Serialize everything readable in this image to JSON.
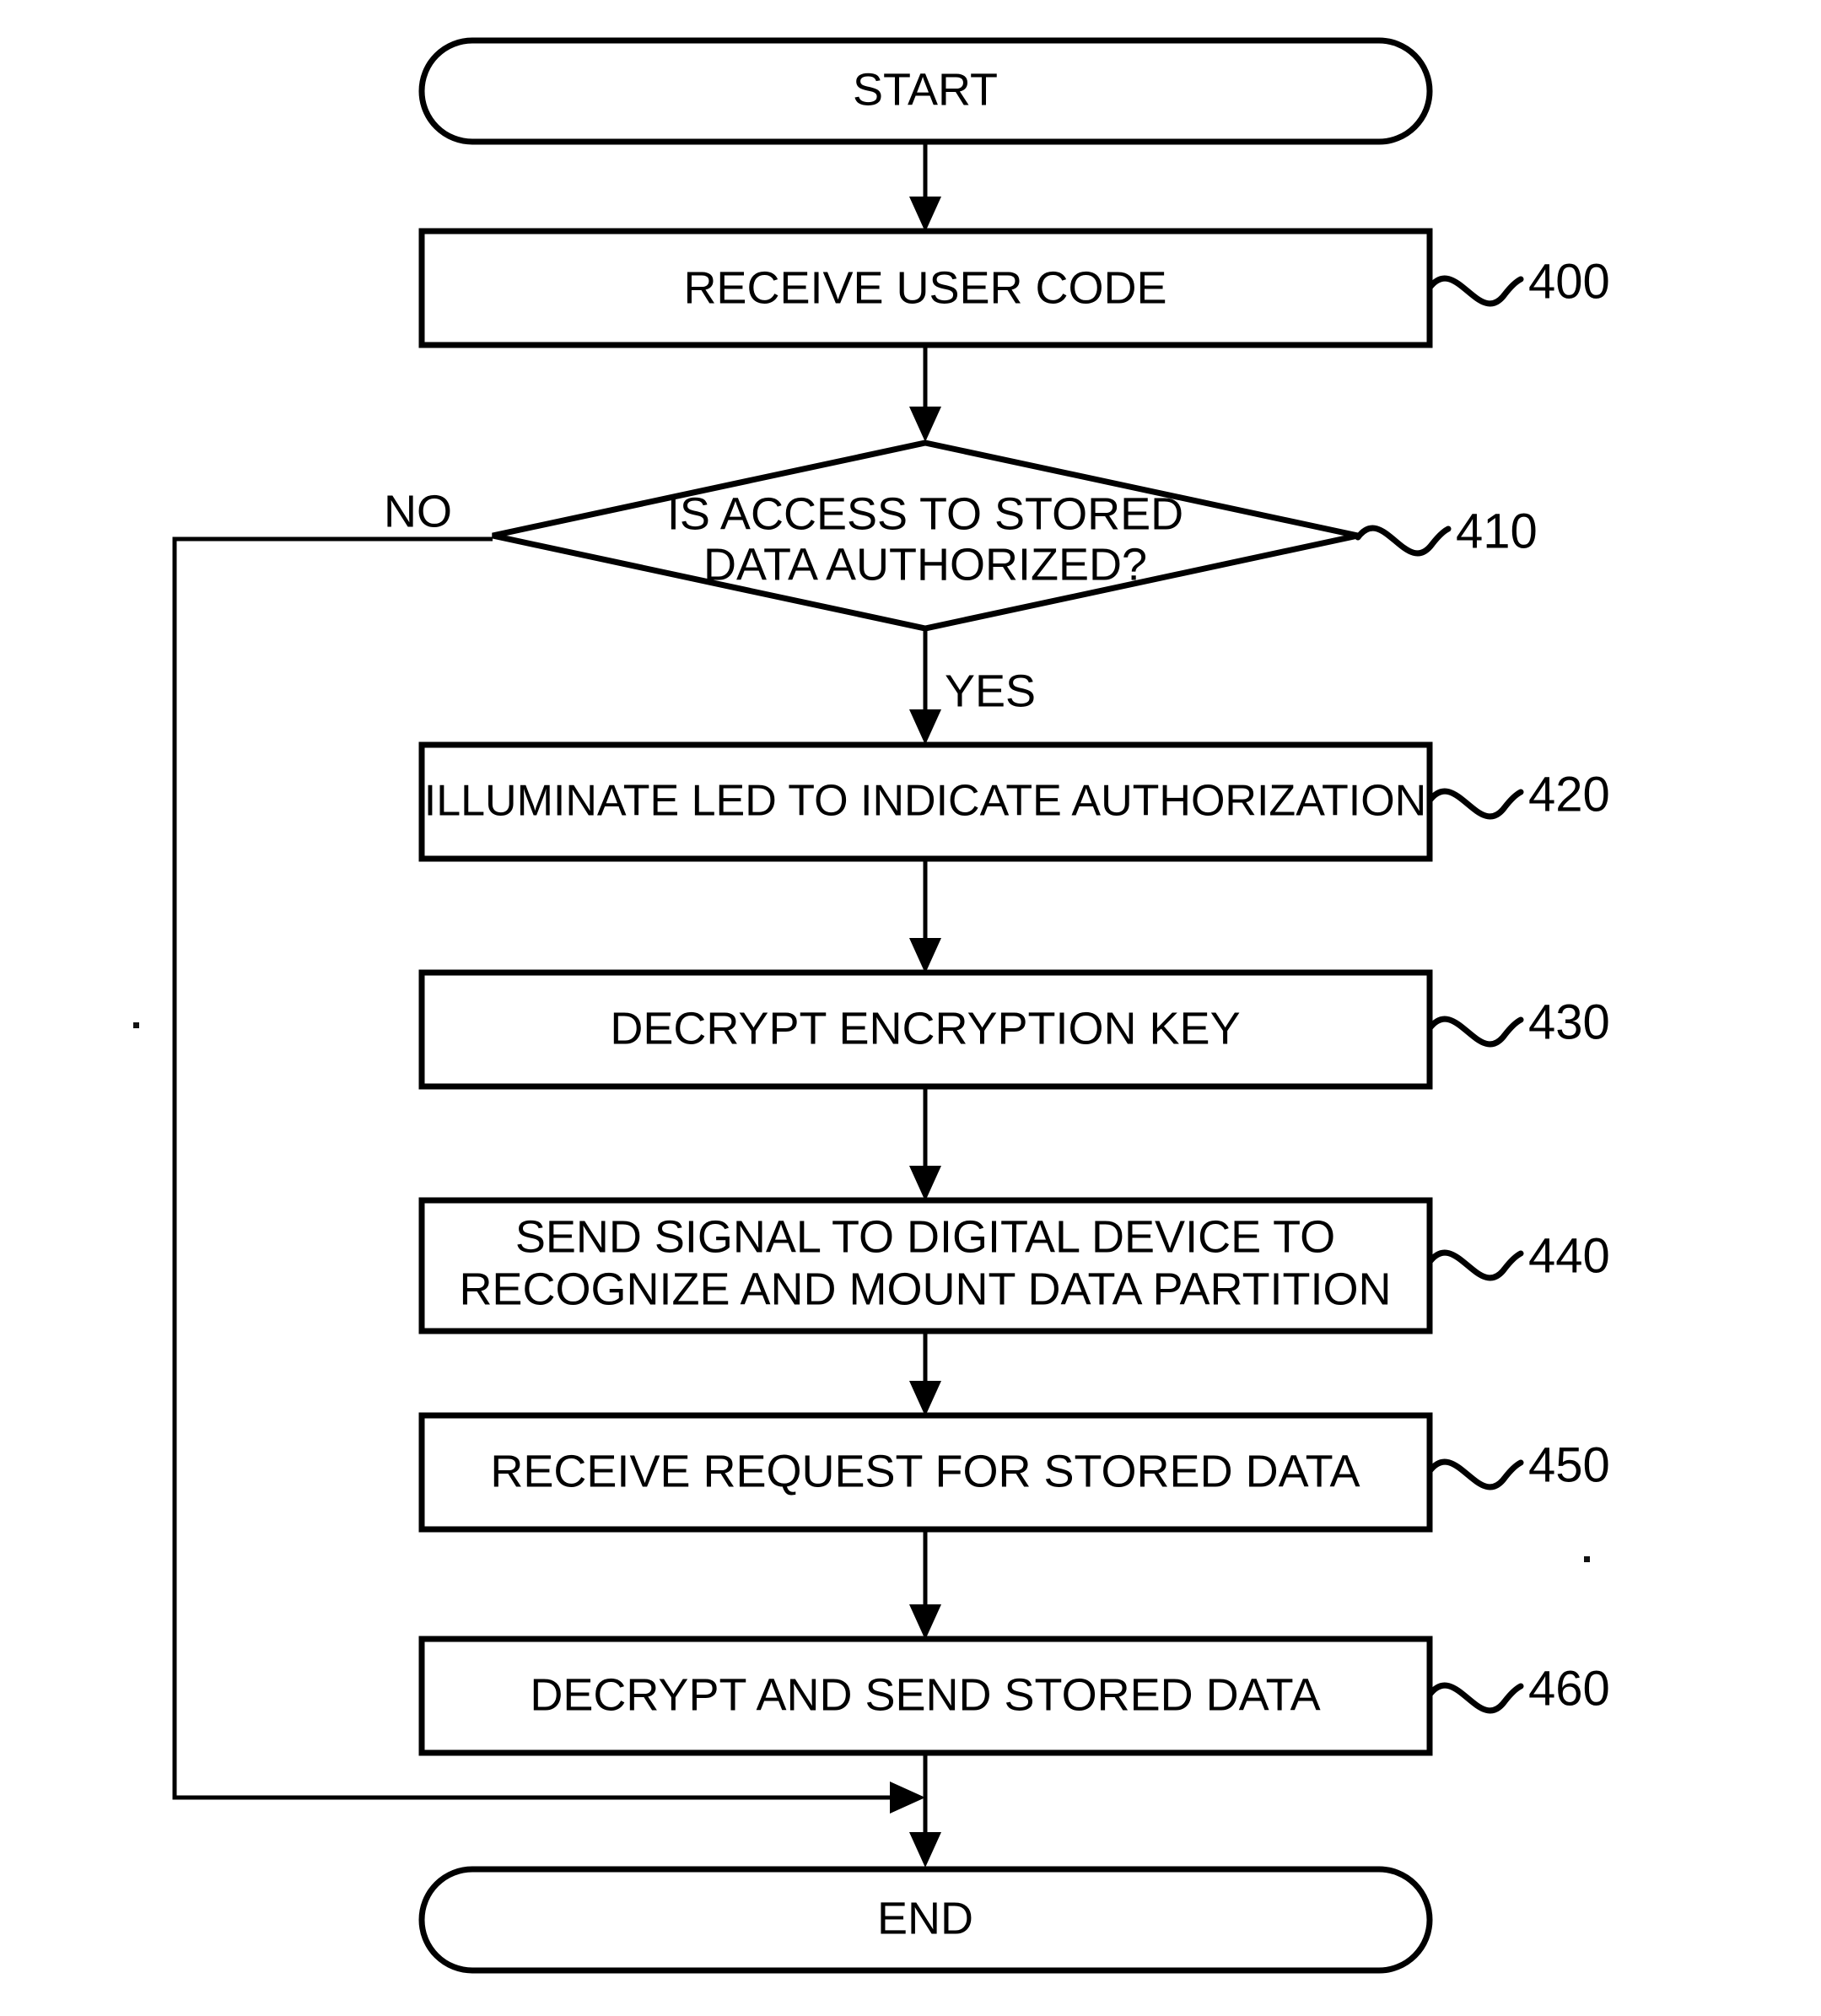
{
  "diagram": {
    "type": "flowchart",
    "title": "",
    "terminators": {
      "start": "START",
      "end": "END"
    },
    "branch_labels": {
      "no": "NO",
      "yes": "YES"
    },
    "nodes": [
      {
        "id": "start",
        "shape": "terminator",
        "text": "START",
        "ref": ""
      },
      {
        "id": "n400",
        "shape": "process",
        "text": "RECEIVE USER CODE",
        "ref": "400"
      },
      {
        "id": "n410",
        "shape": "decision",
        "line1": "IS ACCESS TO STORED",
        "line2": "DATA AUTHORIZED?",
        "ref": "410"
      },
      {
        "id": "n420",
        "shape": "process",
        "text": "ILLUMINATE LED TO INDICATE AUTHORIZATION",
        "ref": "420"
      },
      {
        "id": "n430",
        "shape": "process",
        "text": "DECRYPT ENCRYPTION KEY",
        "ref": "430"
      },
      {
        "id": "n440",
        "shape": "process",
        "line1": "SEND SIGNAL TO DIGITAL DEVICE TO",
        "line2": "RECOGNIZE AND MOUNT DATA PARTITION",
        "ref": "440"
      },
      {
        "id": "n450",
        "shape": "process",
        "text": "RECEIVE REQUEST FOR STORED DATA",
        "ref": "450"
      },
      {
        "id": "n460",
        "shape": "process",
        "text": "DECRYPT AND SEND STORED DATA",
        "ref": "460"
      },
      {
        "id": "end",
        "shape": "terminator",
        "text": "END",
        "ref": ""
      }
    ],
    "refs": {
      "r400": "400",
      "r410": "410",
      "r420": "420",
      "r430": "430",
      "r440": "440",
      "r450": "450",
      "r460": "460"
    },
    "colors": {
      "stroke": "#000000",
      "fill": "#ffffff",
      "text": "#000000"
    }
  }
}
